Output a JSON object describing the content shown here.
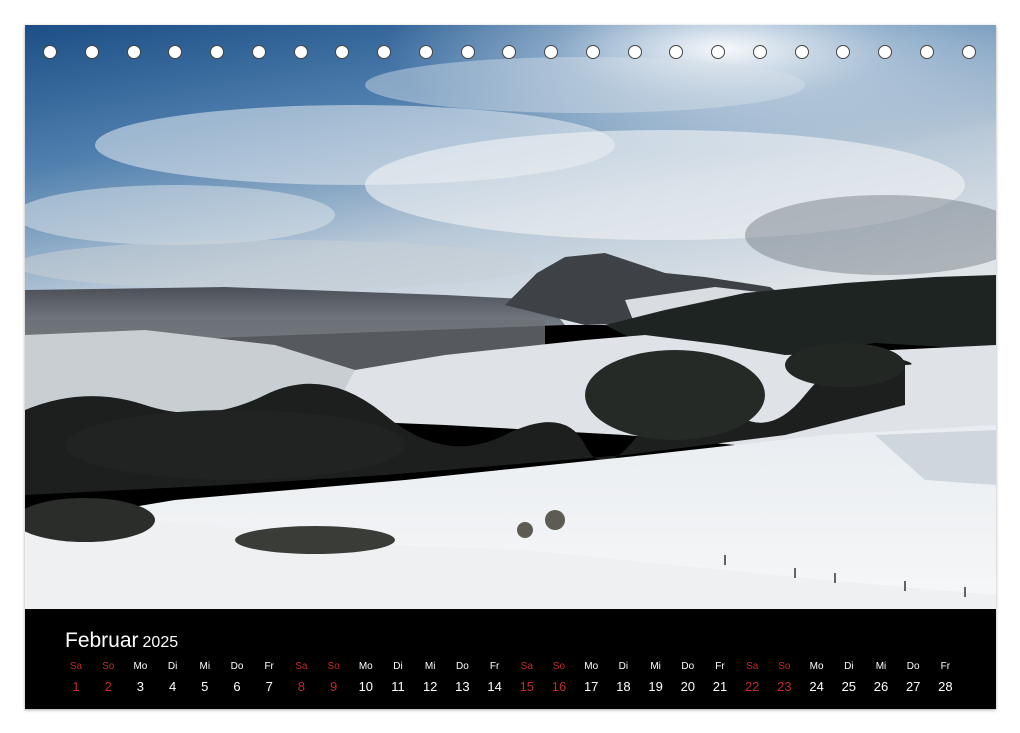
{
  "calendar": {
    "month": "Februar",
    "year": "2025",
    "weekend_color": "#c0282d",
    "days": [
      {
        "dow": "Sa",
        "day": "1",
        "weekend": true
      },
      {
        "dow": "So",
        "day": "2",
        "weekend": true
      },
      {
        "dow": "Mo",
        "day": "3",
        "weekend": false
      },
      {
        "dow": "Di",
        "day": "4",
        "weekend": false
      },
      {
        "dow": "Mi",
        "day": "5",
        "weekend": false
      },
      {
        "dow": "Do",
        "day": "6",
        "weekend": false
      },
      {
        "dow": "Fr",
        "day": "7",
        "weekend": false
      },
      {
        "dow": "Sa",
        "day": "8",
        "weekend": true
      },
      {
        "dow": "So",
        "day": "9",
        "weekend": true
      },
      {
        "dow": "Mo",
        "day": "10",
        "weekend": false
      },
      {
        "dow": "Di",
        "day": "11",
        "weekend": false
      },
      {
        "dow": "Mi",
        "day": "12",
        "weekend": false
      },
      {
        "dow": "Do",
        "day": "13",
        "weekend": false
      },
      {
        "dow": "Fr",
        "day": "14",
        "weekend": false
      },
      {
        "dow": "Sa",
        "day": "15",
        "weekend": true
      },
      {
        "dow": "So",
        "day": "16",
        "weekend": true
      },
      {
        "dow": "Mo",
        "day": "17",
        "weekend": false
      },
      {
        "dow": "Di",
        "day": "18",
        "weekend": false
      },
      {
        "dow": "Mi",
        "day": "19",
        "weekend": false
      },
      {
        "dow": "Do",
        "day": "20",
        "weekend": false
      },
      {
        "dow": "Fr",
        "day": "21",
        "weekend": false
      },
      {
        "dow": "Sa",
        "day": "22",
        "weekend": true
      },
      {
        "dow": "So",
        "day": "23",
        "weekend": true
      },
      {
        "dow": "Mo",
        "day": "24",
        "weekend": false
      },
      {
        "dow": "Di",
        "day": "25",
        "weekend": false
      },
      {
        "dow": "Mi",
        "day": "26",
        "weekend": false
      },
      {
        "dow": "Do",
        "day": "27",
        "weekend": false
      },
      {
        "dow": "Fr",
        "day": "28",
        "weekend": false
      }
    ]
  },
  "binding": {
    "hole_count": 23
  }
}
